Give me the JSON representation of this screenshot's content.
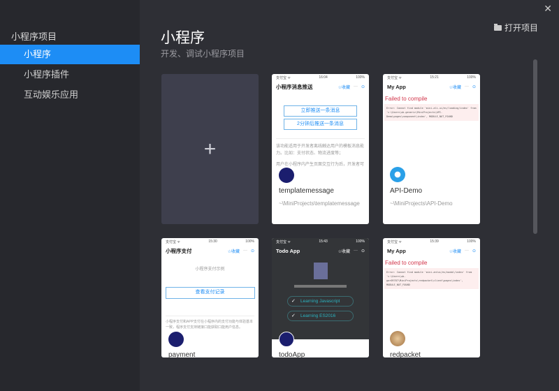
{
  "window": {
    "close_icon": "✕"
  },
  "sidebar": {
    "title": "小程序项目",
    "items": [
      {
        "label": "小程序"
      },
      {
        "label": "小程序插件"
      },
      {
        "label": "互动娱乐应用"
      }
    ]
  },
  "header": {
    "title": "小程序",
    "subtitle": "开发、调试小程序项目",
    "open_label": "打开项目"
  },
  "new_card": {
    "icon": "+"
  },
  "projects": [
    {
      "name": "templatemessage",
      "path": "~\\MiniProjects\\templatemessage",
      "status_left": "支付宝 ᯤ",
      "time": "16:04",
      "battery": "100%",
      "nav_title": "小程序消息推送",
      "fav": "☆收藏",
      "btn1": "立即推送一条消息",
      "btn2": "2分钟后推送一条消息",
      "desc": "该功能适用于开发者离线触达用户的模板消息能力。比如：支付状态、物流进度等；",
      "desc2": "用户在小程序内产生页面交互行为后，开发者可"
    },
    {
      "name": "API-Demo",
      "path": "~\\MiniProjects\\API-Demo",
      "status_left": "支付宝 ᯤ",
      "time": "15:21",
      "battery": "100%",
      "nav_title": "My App",
      "fav": "☆收藏",
      "fail": "Failed to compile",
      "error": "Error: Cannot find module 'mini-ali-ui/es/loading/index' from 'c:\\Users\\ub-generic\\MiniProjects\\API-Demo\\pages\\component\\index', MODULE_NOT_FOUND"
    },
    {
      "name": "payment",
      "status_left": "支付宝 ᯤ",
      "time": "15:30",
      "battery": "100%",
      "nav_title": "小程序支付",
      "fav": "☆收藏",
      "label": "小程序支付示例",
      "btn": "查看支付记录",
      "desc": "小程序支付和APP支付在小程序内的支付功能与体验基本一致，程序支付支持链接口能获取口能用户信息。"
    },
    {
      "name": "todoApp",
      "status_left": "支付宝 ᯤ",
      "time": "15:43",
      "battery": "100%",
      "nav_title": "Todo App",
      "fav": "☆收藏",
      "todos": [
        "Learning Javascript",
        "Learning ES2016"
      ]
    },
    {
      "name": "redpacket",
      "status_left": "支付宝 ᯤ",
      "time": "15:39",
      "battery": "100%",
      "nav_title": "My App",
      "fav": "☆收藏",
      "fail": "Failed to compile",
      "error": "Error: Cannot find module 'mini-antui/es/modal/index' from 'c:\\Users\\ub-gar09787\\MiniProjects\\redpacket\\client\\pages\\index', MODULE_NOT_FOUND"
    }
  ]
}
